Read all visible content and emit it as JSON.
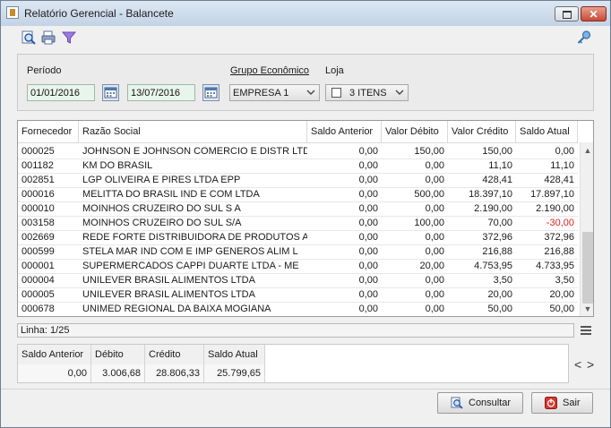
{
  "window": {
    "title": "Relatório Gerencial - Balancete"
  },
  "toolbar": {
    "icons": [
      "preview-icon",
      "print-icon",
      "filter-icon",
      "key-icon"
    ]
  },
  "filters": {
    "periodo_label": "Período",
    "data_inicio": "01/01/2016",
    "data_fim": "13/07/2016",
    "grupo_label": "Grupo Econômico",
    "grupo_value": "EMPRESA 1",
    "loja_label": "Loja",
    "loja_value": "3 ITENS"
  },
  "grid": {
    "headers": [
      "Fornecedor",
      "Razão Social",
      "Saldo Anterior",
      "Valor Débito",
      "Valor Crédito",
      "Saldo Atual"
    ],
    "rows": [
      {
        "fornecedor": "000025",
        "razao": "JOHNSON E JOHNSON COMERCIO E DISTR LTD",
        "saldo_anterior": "0,00",
        "debito": "150,00",
        "credito": "150,00",
        "saldo_atual": "0,00"
      },
      {
        "fornecedor": "001182",
        "razao": "KM DO BRASIL",
        "saldo_anterior": "0,00",
        "debito": "0,00",
        "credito": "11,10",
        "saldo_atual": "11,10"
      },
      {
        "fornecedor": "002851",
        "razao": "LGP OLIVEIRA E PIRES LTDA EPP",
        "saldo_anterior": "0,00",
        "debito": "0,00",
        "credito": "428,41",
        "saldo_atual": "428,41"
      },
      {
        "fornecedor": "000016",
        "razao": "MELITTA DO BRASIL IND E COM LTDA",
        "saldo_anterior": "0,00",
        "debito": "500,00",
        "credito": "18.397,10",
        "saldo_atual": "17.897,10"
      },
      {
        "fornecedor": "000010",
        "razao": "MOINHOS CRUZEIRO DO SUL S A",
        "saldo_anterior": "0,00",
        "debito": "0,00",
        "credito": "2.190,00",
        "saldo_atual": "2.190,00"
      },
      {
        "fornecedor": "003158",
        "razao": "MOINHOS CRUZEIRO DO SUL S/A",
        "saldo_anterior": "0,00",
        "debito": "100,00",
        "credito": "70,00",
        "saldo_atual": "-30,00"
      },
      {
        "fornecedor": "002669",
        "razao": "REDE FORTE DISTRIBUIDORA DE PRODUTOS ALI",
        "saldo_anterior": "0,00",
        "debito": "0,00",
        "credito": "372,96",
        "saldo_atual": "372,96"
      },
      {
        "fornecedor": "000599",
        "razao": "STELA MAR IND COM E IMP GENEROS ALIM L",
        "saldo_anterior": "0,00",
        "debito": "0,00",
        "credito": "216,88",
        "saldo_atual": "216,88"
      },
      {
        "fornecedor": "000001",
        "razao": "SUPERMERCADOS CAPPI DUARTE LTDA - ME",
        "saldo_anterior": "0,00",
        "debito": "20,00",
        "credito": "4.753,95",
        "saldo_atual": "4.733,95"
      },
      {
        "fornecedor": "000004",
        "razao": "UNILEVER BRASIL ALIMENTOS LTDA",
        "saldo_anterior": "0,00",
        "debito": "0,00",
        "credito": "3,50",
        "saldo_atual": "3,50"
      },
      {
        "fornecedor": "000005",
        "razao": "UNILEVER BRASIL ALIMENTOS LTDA",
        "saldo_anterior": "0,00",
        "debito": "0,00",
        "credito": "20,00",
        "saldo_atual": "20,00"
      },
      {
        "fornecedor": "000678",
        "razao": "UNIMED REGIONAL DA BAIXA MOGIANA",
        "saldo_anterior": "0,00",
        "debito": "0,00",
        "credito": "50,00",
        "saldo_atual": "50,00"
      }
    ]
  },
  "status": {
    "linha": "Linha: 1/25"
  },
  "totals": {
    "headers": [
      "Saldo Anterior",
      "Débito",
      "Crédito",
      "Saldo Atual"
    ],
    "values": [
      "0,00",
      "3.006,68",
      "28.806,33",
      "25.799,65"
    ]
  },
  "nav": {
    "prev": "<",
    "next": ">"
  },
  "actions": {
    "consultar": "Consultar",
    "sair": "Sair"
  },
  "colors": {
    "negative": "#e02020",
    "date_bg": "#e8f5ec"
  }
}
